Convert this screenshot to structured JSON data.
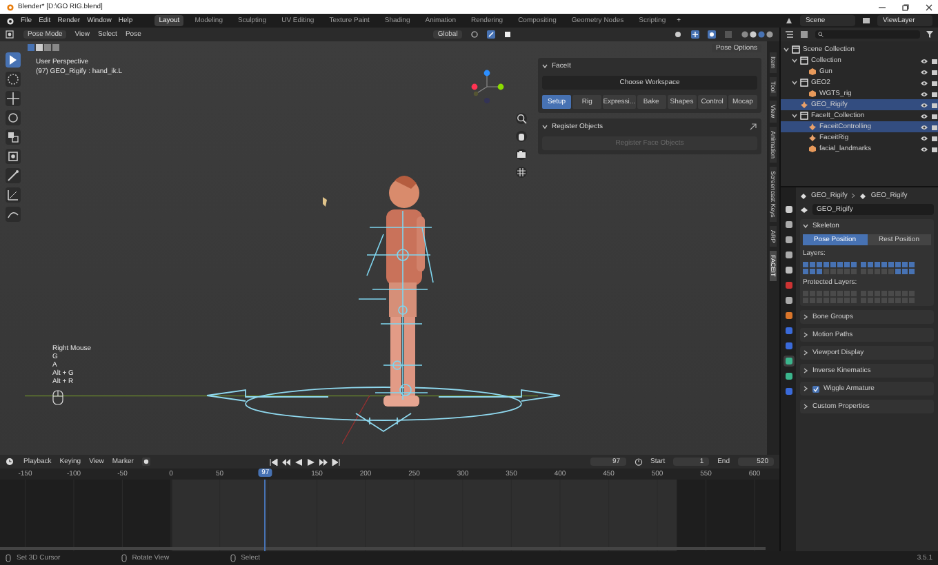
{
  "window": {
    "title": "Blender* [D:\\GO RIG.blend]"
  },
  "menu": [
    "File",
    "Edit",
    "Render",
    "Window",
    "Help"
  ],
  "workspaces": [
    {
      "label": "Layout",
      "selected": true
    },
    {
      "label": "Modeling",
      "selected": false
    },
    {
      "label": "Sculpting",
      "selected": false
    },
    {
      "label": "UV Editing",
      "selected": false
    },
    {
      "label": "Texture Paint",
      "selected": false
    },
    {
      "label": "Shading",
      "selected": false
    },
    {
      "label": "Animation",
      "selected": false
    },
    {
      "label": "Rendering",
      "selected": false
    },
    {
      "label": "Compositing",
      "selected": false
    },
    {
      "label": "Geometry Nodes",
      "selected": false
    },
    {
      "label": "Scripting",
      "selected": false
    }
  ],
  "add_workspace": "+",
  "scene": "Scene",
  "view_layer": "ViewLayer",
  "viewport": {
    "mode": "Pose Mode",
    "menus": [
      "View",
      "Select",
      "Pose"
    ],
    "orientation": "Global",
    "pose_options": "Pose Options",
    "view_name": "User Perspective",
    "object_info": "(97) GEO_Rigify : hand_ik.L",
    "tools": [
      {
        "selected": true
      },
      {
        "selected": false
      },
      {
        "selected": false
      },
      {
        "selected": false
      },
      {
        "selected": false
      },
      {
        "selected": false
      },
      {
        "selected": false
      },
      {
        "selected": false
      },
      {
        "selected": false
      }
    ],
    "screencast_keys": [
      "Right Mouse",
      "G",
      "A",
      "Alt + G",
      "Alt + R"
    ],
    "side_tabs": [
      {
        "label": "Item",
        "selected": false
      },
      {
        "label": "Tool",
        "selected": false
      },
      {
        "label": "View",
        "selected": false
      },
      {
        "label": "Animation",
        "selected": false
      },
      {
        "label": "Screencast Keys",
        "selected": false
      },
      {
        "label": "ARP",
        "selected": false
      },
      {
        "label": "FACEIT",
        "selected": true
      }
    ]
  },
  "faceit": {
    "title": "FaceIt",
    "expanded": true,
    "workspace": "Choose Workspace",
    "tabs": [
      {
        "label": "Setup",
        "selected": true
      },
      {
        "label": "Rig",
        "selected": false
      },
      {
        "label": "Expressi...",
        "selected": false
      },
      {
        "label": "Bake",
        "selected": false
      },
      {
        "label": "Shapes",
        "selected": false
      },
      {
        "label": "Control",
        "selected": false
      },
      {
        "label": "Mocap",
        "selected": false
      }
    ],
    "register": {
      "title": "Register Objects",
      "expanded": true,
      "button": "Register Face Objects",
      "disabled": true
    }
  },
  "outliner": {
    "items": [
      {
        "label": "Scene Collection",
        "kind": "collection",
        "selected": false,
        "children": [
          {
            "label": "Collection",
            "kind": "collection",
            "selected": false,
            "children": [
              {
                "label": "Gun",
                "kind": "mesh",
                "selected": false
              }
            ]
          },
          {
            "label": "GEO2",
            "kind": "collection",
            "selected": false,
            "children": [
              {
                "label": "WGTS_rig",
                "kind": "mesh",
                "selected": false
              }
            ]
          },
          {
            "label": "GEO_Rigify",
            "kind": "armature",
            "selected": true
          },
          {
            "label": "FaceIt_Collection",
            "kind": "collection",
            "selected": false,
            "children": [
              {
                "label": "FaceitControlling",
                "kind": "armature",
                "selected": true
              },
              {
                "label": "FaceitRig",
                "kind": "armature",
                "selected": false
              },
              {
                "label": "facial_landmarks",
                "kind": "mesh",
                "selected": false
              }
            ]
          }
        ]
      }
    ]
  },
  "properties": {
    "tabs": [
      {
        "selected": false
      },
      {
        "selected": false
      },
      {
        "selected": false
      },
      {
        "selected": false
      },
      {
        "selected": false
      },
      {
        "selected": false
      },
      {
        "selected": false
      },
      {
        "selected": false
      },
      {
        "selected": false
      },
      {
        "selected": false
      },
      {
        "selected": true
      },
      {
        "selected": false
      },
      {
        "selected": false
      }
    ],
    "breadcrumb": [
      "GEO_Rigify",
      "GEO_Rigify"
    ],
    "data_name": "GEO_Rigify",
    "skeleton": {
      "title": "Skeleton",
      "expanded": true,
      "positions": [
        {
          "label": "Pose Position",
          "selected": true
        },
        {
          "label": "Rest Position",
          "selected": false
        }
      ],
      "layers_label": "Layers:",
      "layers": [
        {
          "on": true
        },
        {
          "on": true
        },
        {
          "on": true
        },
        {
          "on": true
        },
        {
          "on": true
        },
        {
          "on": true
        },
        {
          "on": true
        },
        {
          "on": true
        },
        {
          "on": true
        },
        {
          "on": true
        },
        {
          "on": true
        },
        {
          "on": true
        },
        {
          "on": true
        },
        {
          "on": true
        },
        {
          "on": true
        },
        {
          "on": true
        },
        {
          "on": true
        },
        {
          "on": true
        },
        {
          "on": true
        },
        {
          "on": false
        },
        {
          "on": false
        },
        {
          "on": false
        },
        {
          "on": false
        },
        {
          "on": false
        },
        {
          "on": false
        },
        {
          "on": false
        },
        {
          "on": false
        },
        {
          "on": false
        },
        {
          "on": false
        },
        {
          "on": true
        },
        {
          "on": true
        },
        {
          "on": true
        }
      ],
      "protected_label": "Protected Layers:",
      "protected": [
        {
          "on": false
        },
        {
          "on": false
        },
        {
          "on": false
        },
        {
          "on": false
        },
        {
          "on": false
        },
        {
          "on": false
        },
        {
          "on": false
        },
        {
          "on": false
        },
        {
          "on": false
        },
        {
          "on": false
        },
        {
          "on": false
        },
        {
          "on": false
        },
        {
          "on": false
        },
        {
          "on": false
        },
        {
          "on": false
        },
        {
          "on": false
        },
        {
          "on": false
        },
        {
          "on": false
        },
        {
          "on": false
        },
        {
          "on": false
        },
        {
          "on": false
        },
        {
          "on": false
        },
        {
          "on": false
        },
        {
          "on": false
        },
        {
          "on": false
        },
        {
          "on": false
        },
        {
          "on": false
        },
        {
          "on": false
        },
        {
          "on": false
        },
        {
          "on": false
        },
        {
          "on": false
        },
        {
          "on": false
        }
      ]
    },
    "subpanels": [
      {
        "label": "Bone Groups",
        "kind": "plain",
        "expanded": false
      },
      {
        "label": "Motion Paths",
        "kind": "plain",
        "expanded": false
      },
      {
        "label": "Viewport Display",
        "kind": "plain",
        "expanded": false
      },
      {
        "label": "Inverse Kinematics",
        "kind": "plain",
        "expanded": false
      },
      {
        "label": "Wiggle Armature",
        "kind": "checkbox",
        "expanded": false,
        "checked": true
      },
      {
        "label": "Custom Properties",
        "kind": "plain",
        "expanded": false
      }
    ]
  },
  "timeline": {
    "menus": [
      "Playback",
      "Keying",
      "View",
      "Marker"
    ],
    "current_frame": "97",
    "playhead_frame": "97",
    "start_label": "Start",
    "start": "1",
    "end_label": "End",
    "end": "520",
    "ticks": [
      "-150",
      "-100",
      "-50",
      "0",
      "50",
      "150",
      "200",
      "250",
      "300",
      "350",
      "400",
      "450",
      "500",
      "550",
      "600"
    ]
  },
  "status_bar": {
    "hints": [
      "Set 3D Cursor",
      "Rotate View",
      "Select"
    ],
    "version": "3.5.1"
  }
}
